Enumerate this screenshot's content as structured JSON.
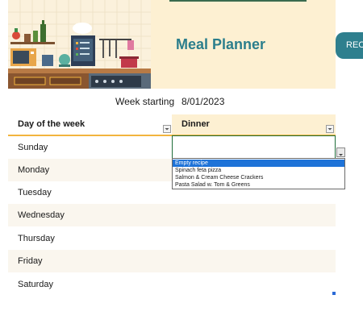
{
  "header": {
    "title": "Meal Planner",
    "recipes_button_label": "REC"
  },
  "week": {
    "label": "Week starting",
    "value": "8/01/2023"
  },
  "table": {
    "col_day": "Day of the week",
    "col_dinner": "Dinner",
    "days": [
      "Sunday",
      "Monday",
      "Tuesday",
      "Wednesday",
      "Thursday",
      "Friday",
      "Saturday"
    ]
  },
  "dropdown": {
    "options": [
      "Empty recipe",
      "Spinach feta pizza",
      "Salmon & Cream Cheese Crackers",
      "Pasta Salad w. Tom & Greens"
    ],
    "highlighted": "Empty recipe"
  },
  "colors": {
    "accent_teal": "#2b7e8c",
    "header_band": "#fdf0d2",
    "underline_gold": "#f2b43e",
    "selection_blue": "#1e73d8"
  }
}
